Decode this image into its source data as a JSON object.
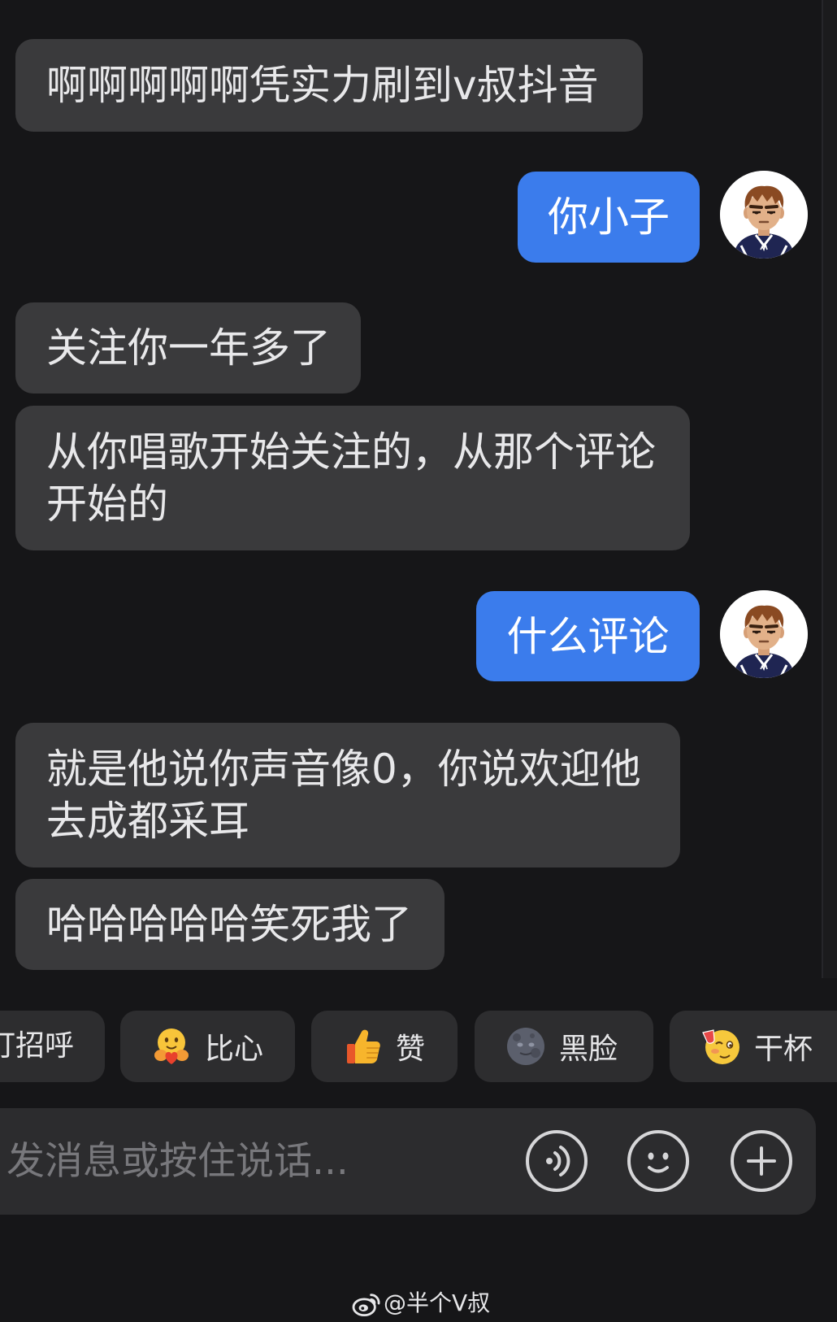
{
  "colors": {
    "background": "#161618",
    "received_bubble": "#3a3a3c",
    "sent_bubble": "#3b7cec",
    "text": "#e8e8ea",
    "chip_bg": "#2d2d2f",
    "input_bg": "#2c2c2e",
    "placeholder": "#78787c"
  },
  "messages": [
    {
      "side": "received",
      "lines": [
        "啊啊啊啊啊凭实力刷到v叔抖音"
      ]
    },
    {
      "side": "sent",
      "lines": [
        "你小子"
      ],
      "avatar": "cartoon-boy-avatar"
    },
    {
      "side": "received",
      "lines": [
        "关注你一年多了"
      ]
    },
    {
      "side": "received",
      "lines": [
        "从你唱歌开始关注的，从那个评论",
        "开始的"
      ]
    },
    {
      "side": "sent",
      "lines": [
        "什么评论"
      ],
      "avatar": "cartoon-boy-avatar"
    },
    {
      "side": "received",
      "lines": [
        "就是他说你声音像0，你说欢迎他",
        "去成都采耳"
      ]
    },
    {
      "side": "received",
      "lines": [
        "哈哈哈哈哈笑死我了"
      ]
    }
  ],
  "quick_replies": [
    {
      "label": "打招呼"
    },
    {
      "label": "比心",
      "icon": "heart-hands-emoji"
    },
    {
      "label": "赞",
      "icon": "thumbs-up-emoji"
    },
    {
      "label": "黑脸",
      "icon": "moon-face-emoji"
    },
    {
      "label": "干杯",
      "icon": "cheers-emoji"
    }
  ],
  "input": {
    "placeholder": "发消息或按住说话...",
    "buttons": [
      "voice-icon",
      "emoji-icon",
      "plus-icon"
    ]
  },
  "watermark": {
    "icon": "weibo-icon",
    "text": "@半个V叔"
  }
}
